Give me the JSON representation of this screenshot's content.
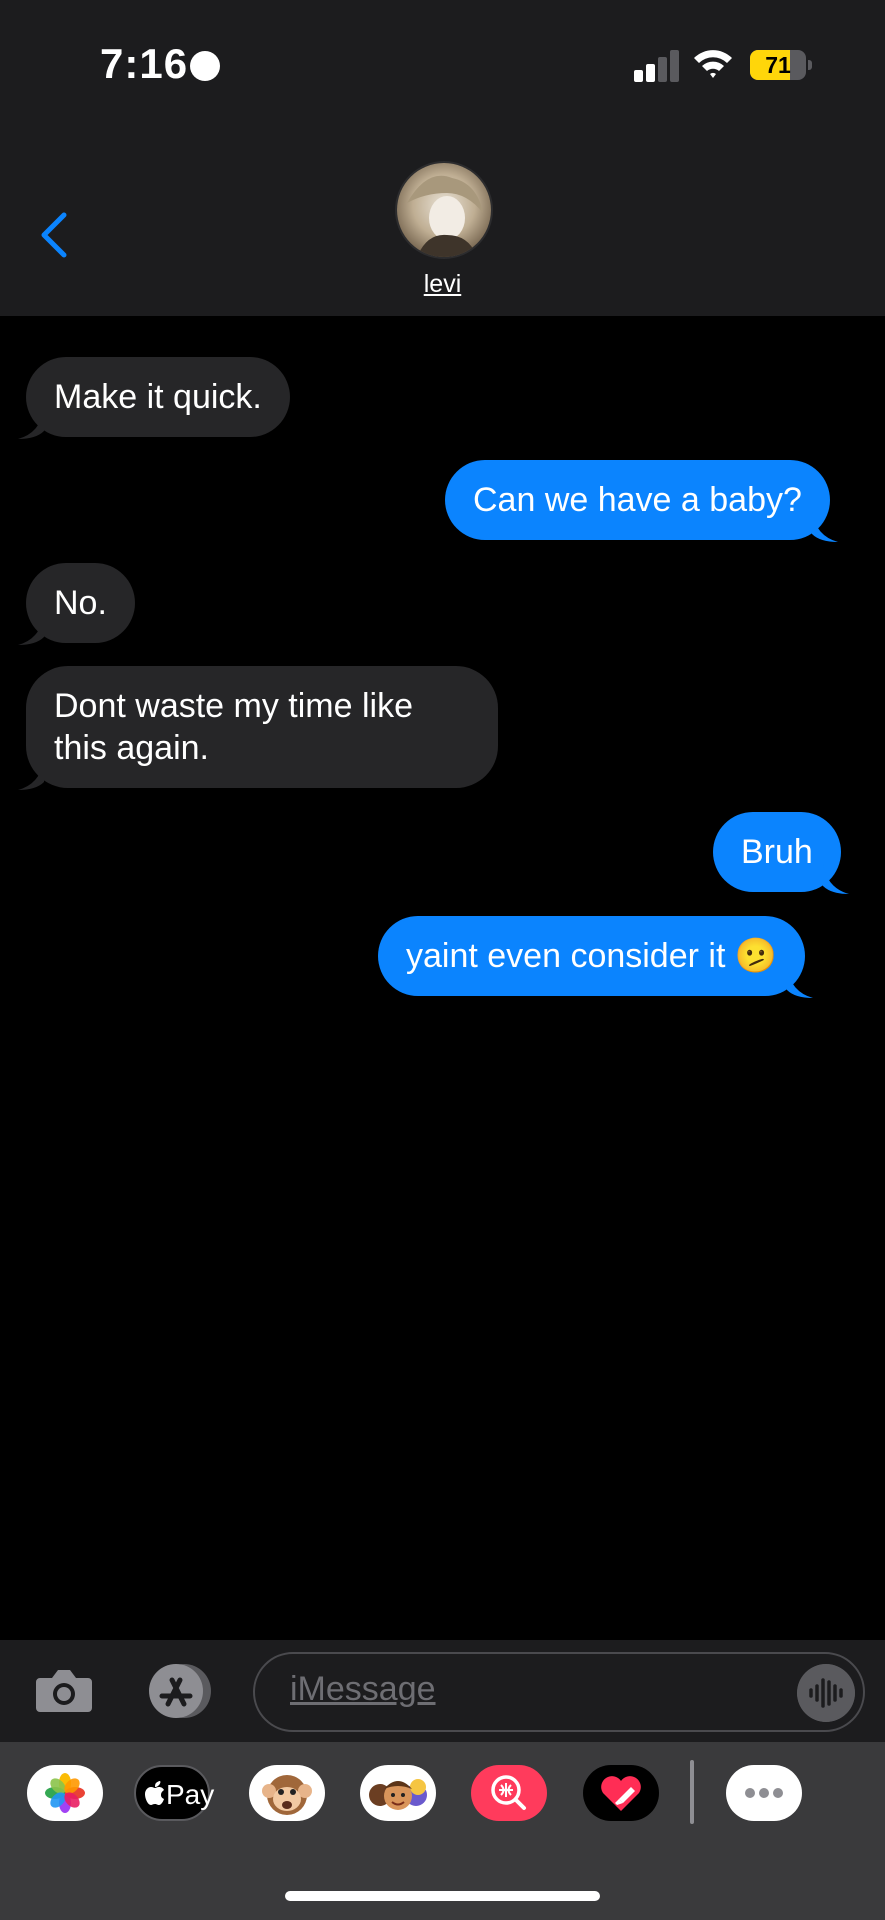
{
  "status_bar": {
    "time": "7:16",
    "battery": "71",
    "battery_level": 0.71,
    "signal_bars": 2,
    "battery_color": "#ffd60a"
  },
  "header": {
    "back_icon": "chevron-left-icon",
    "contact_name": "levi",
    "accent_color": "#0b84fe"
  },
  "messages": [
    {
      "direction": "incoming",
      "text": "Make it quick."
    },
    {
      "direction": "outgoing",
      "text": "Can we have a baby?"
    },
    {
      "direction": "incoming",
      "text": "No."
    },
    {
      "direction": "incoming",
      "text": "Dont waste my time like this again."
    },
    {
      "direction": "outgoing",
      "text": "Bruh"
    },
    {
      "direction": "outgoing",
      "text": "yaint even consider it 🫤"
    }
  ],
  "input": {
    "placeholder": "iMessage",
    "camera_icon": "camera-icon",
    "apps_icon": "app-store-icon",
    "mic_icon": "waveform-icon"
  },
  "app_drawer": {
    "apps": [
      {
        "name": "photos-icon"
      },
      {
        "name": "apple-pay-icon",
        "label": "Pay"
      },
      {
        "name": "animoji-icon"
      },
      {
        "name": "memoji-icon"
      },
      {
        "name": "image-search-icon"
      },
      {
        "name": "digital-touch-icon"
      },
      {
        "name": "more-icon"
      }
    ]
  }
}
